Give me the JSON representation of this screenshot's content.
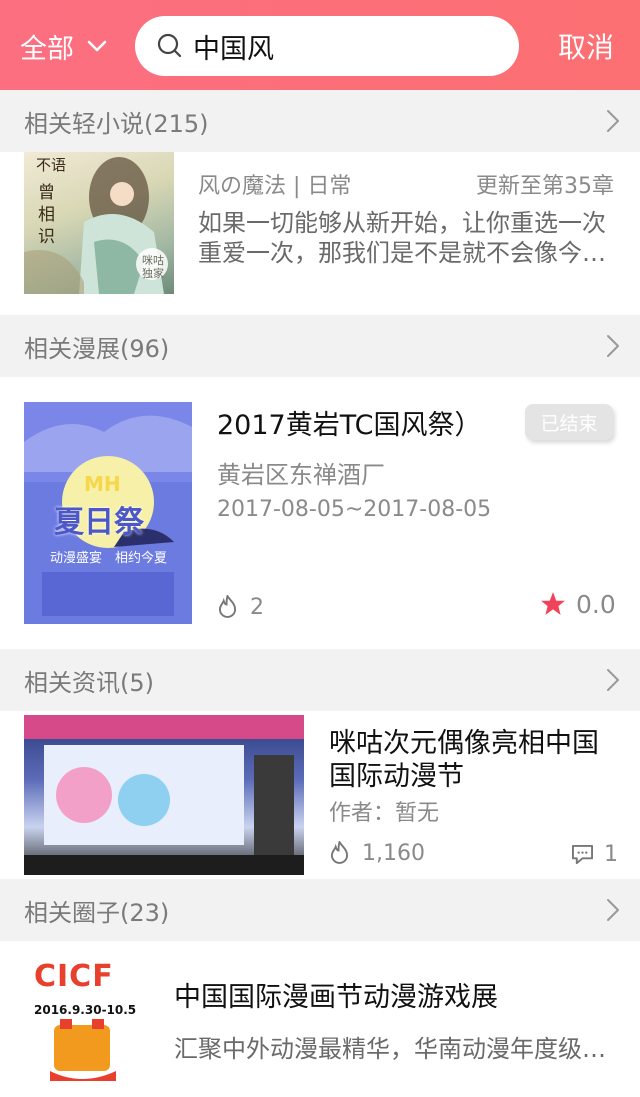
{
  "header": {
    "scope_label": "全部",
    "search_value": "中国风",
    "cancel_label": "取消"
  },
  "sections": {
    "novels": {
      "title": "相关轻小说(215)",
      "item": {
        "cover_text_1": "不语",
        "cover_text_2": "曾相识",
        "cover_badge": "咪咕独家",
        "meta_left": "风の魔法 | 日常",
        "meta_right": "更新至第35章",
        "desc": "如果一切能够从新开始，让你重选一次重爱一次，那我们是不是就不会像今天这样"
      }
    },
    "exhibitions": {
      "title": "相关漫展(96)",
      "item": {
        "title": "2017黄岩TC国风祭）",
        "badge": "已结束",
        "location": "黄岩区东禅酒厂",
        "dates": "2017-08-05~2017-08-05",
        "heat": "2",
        "rating": "0.0",
        "poster_mh": "MH",
        "poster_title": "夏日祭",
        "poster_slogan": "动漫盛宴　相约今夏"
      }
    },
    "news": {
      "title": "相关资讯(5)",
      "item": {
        "title": "咪咕次元偶像亮相中国国际动漫节",
        "author": "作者：暂无",
        "views": "1,160",
        "comments": "1"
      }
    },
    "circles": {
      "title": "相关圈子(23)",
      "item": {
        "title": "中国国际漫画节动漫游戏展",
        "desc": "汇聚中外动漫最精华，华南动漫年度级盛会",
        "logo_text": "CICF",
        "logo_date": "2016.9.30-10.5"
      }
    }
  },
  "colors": {
    "header_gradient": "#fb6f81",
    "accent_star": "#f0435a",
    "badge_bg": "#e4e4e4"
  }
}
